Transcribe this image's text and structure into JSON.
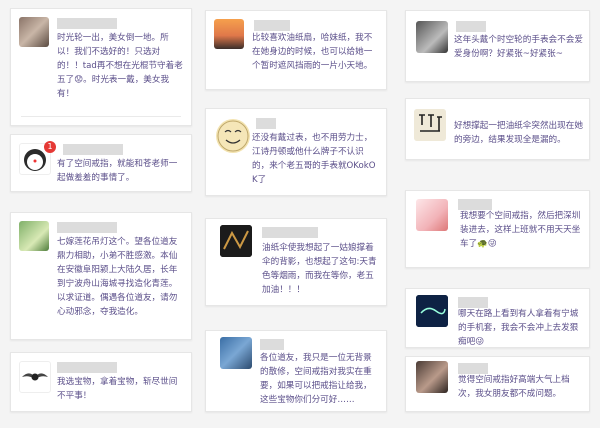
{
  "comments": [
    {
      "text": "时光轮一出，美女倒一地。所以！我们不选好的！只选对的！！tad再不想在光棍节守着老五了😟。时光表一戴，美女我有！"
    },
    {
      "text": "比较喜欢油纸扇，哈妹纸，我不在她身边的时候，也可以给她一个暂时遮风挡雨的一片小天地。"
    },
    {
      "text": "这年头戴个时空轮的手表会不会爱爱身份啊？好紧张~好紧张~"
    },
    {
      "text": "有了空间戒指，就能和苍老师一起做羞羞的事情了。"
    },
    {
      "text": "还没有戴过表，也不用劳力士，江诗丹顿或他什么牌子不认识的，来个老五哥的手表就OKokOK了"
    },
    {
      "text": "好想撑起一把油纸伞突然出现在她的旁边，结果发现全是漏的。"
    },
    {
      "text": "七嫁莲花吊灯这个。望各位道友鼎力相助，小弟不胜感激。本仙在安徽阜阳颍上大陆久居，长年到宁波舟山海城寻找造化青莲。以求证道。偶遇各位道友，请勿心动邪念，夺我造化。"
    },
    {
      "text": "油纸伞使我想起了一姑娘撑着伞的背影，也想起了这句:天青色等烟雨，而我在等你，老五加油！！！"
    },
    {
      "text": "我想要个空间戒指，然后把深圳装进去，这样上班就不用天天坐车了🐢😜"
    },
    {
      "text": "哪天在路上看到有人拿着有宁城的手机套，我会不会冲上去发狠痴吧😜"
    },
    {
      "text": "我选宝物，拿着宝物，斩尽世间不平事！"
    },
    {
      "text": "各位道友，我只是一位无背景的散修，空间戒指对我实在重要，如果可以把戒指让给我，这些宝物你们分可好……"
    },
    {
      "text": "觉得空间戒指好高端大气上档次，我女朋友都不成问题。"
    }
  ],
  "badge": {
    "count": "1"
  },
  "icons": [
    "avatar-woman",
    "avatar-man-sunset",
    "avatar-man-cap",
    "avatar-doraemon",
    "avatar-meme-face",
    "avatar-calligraphy",
    "avatar-boy-green",
    "avatar-dark-pattern",
    "avatar-man-laughing",
    "avatar-bentley-logo",
    "avatar-man-blue",
    "avatar-dark-text",
    "avatar-woman-long-hair"
  ]
}
